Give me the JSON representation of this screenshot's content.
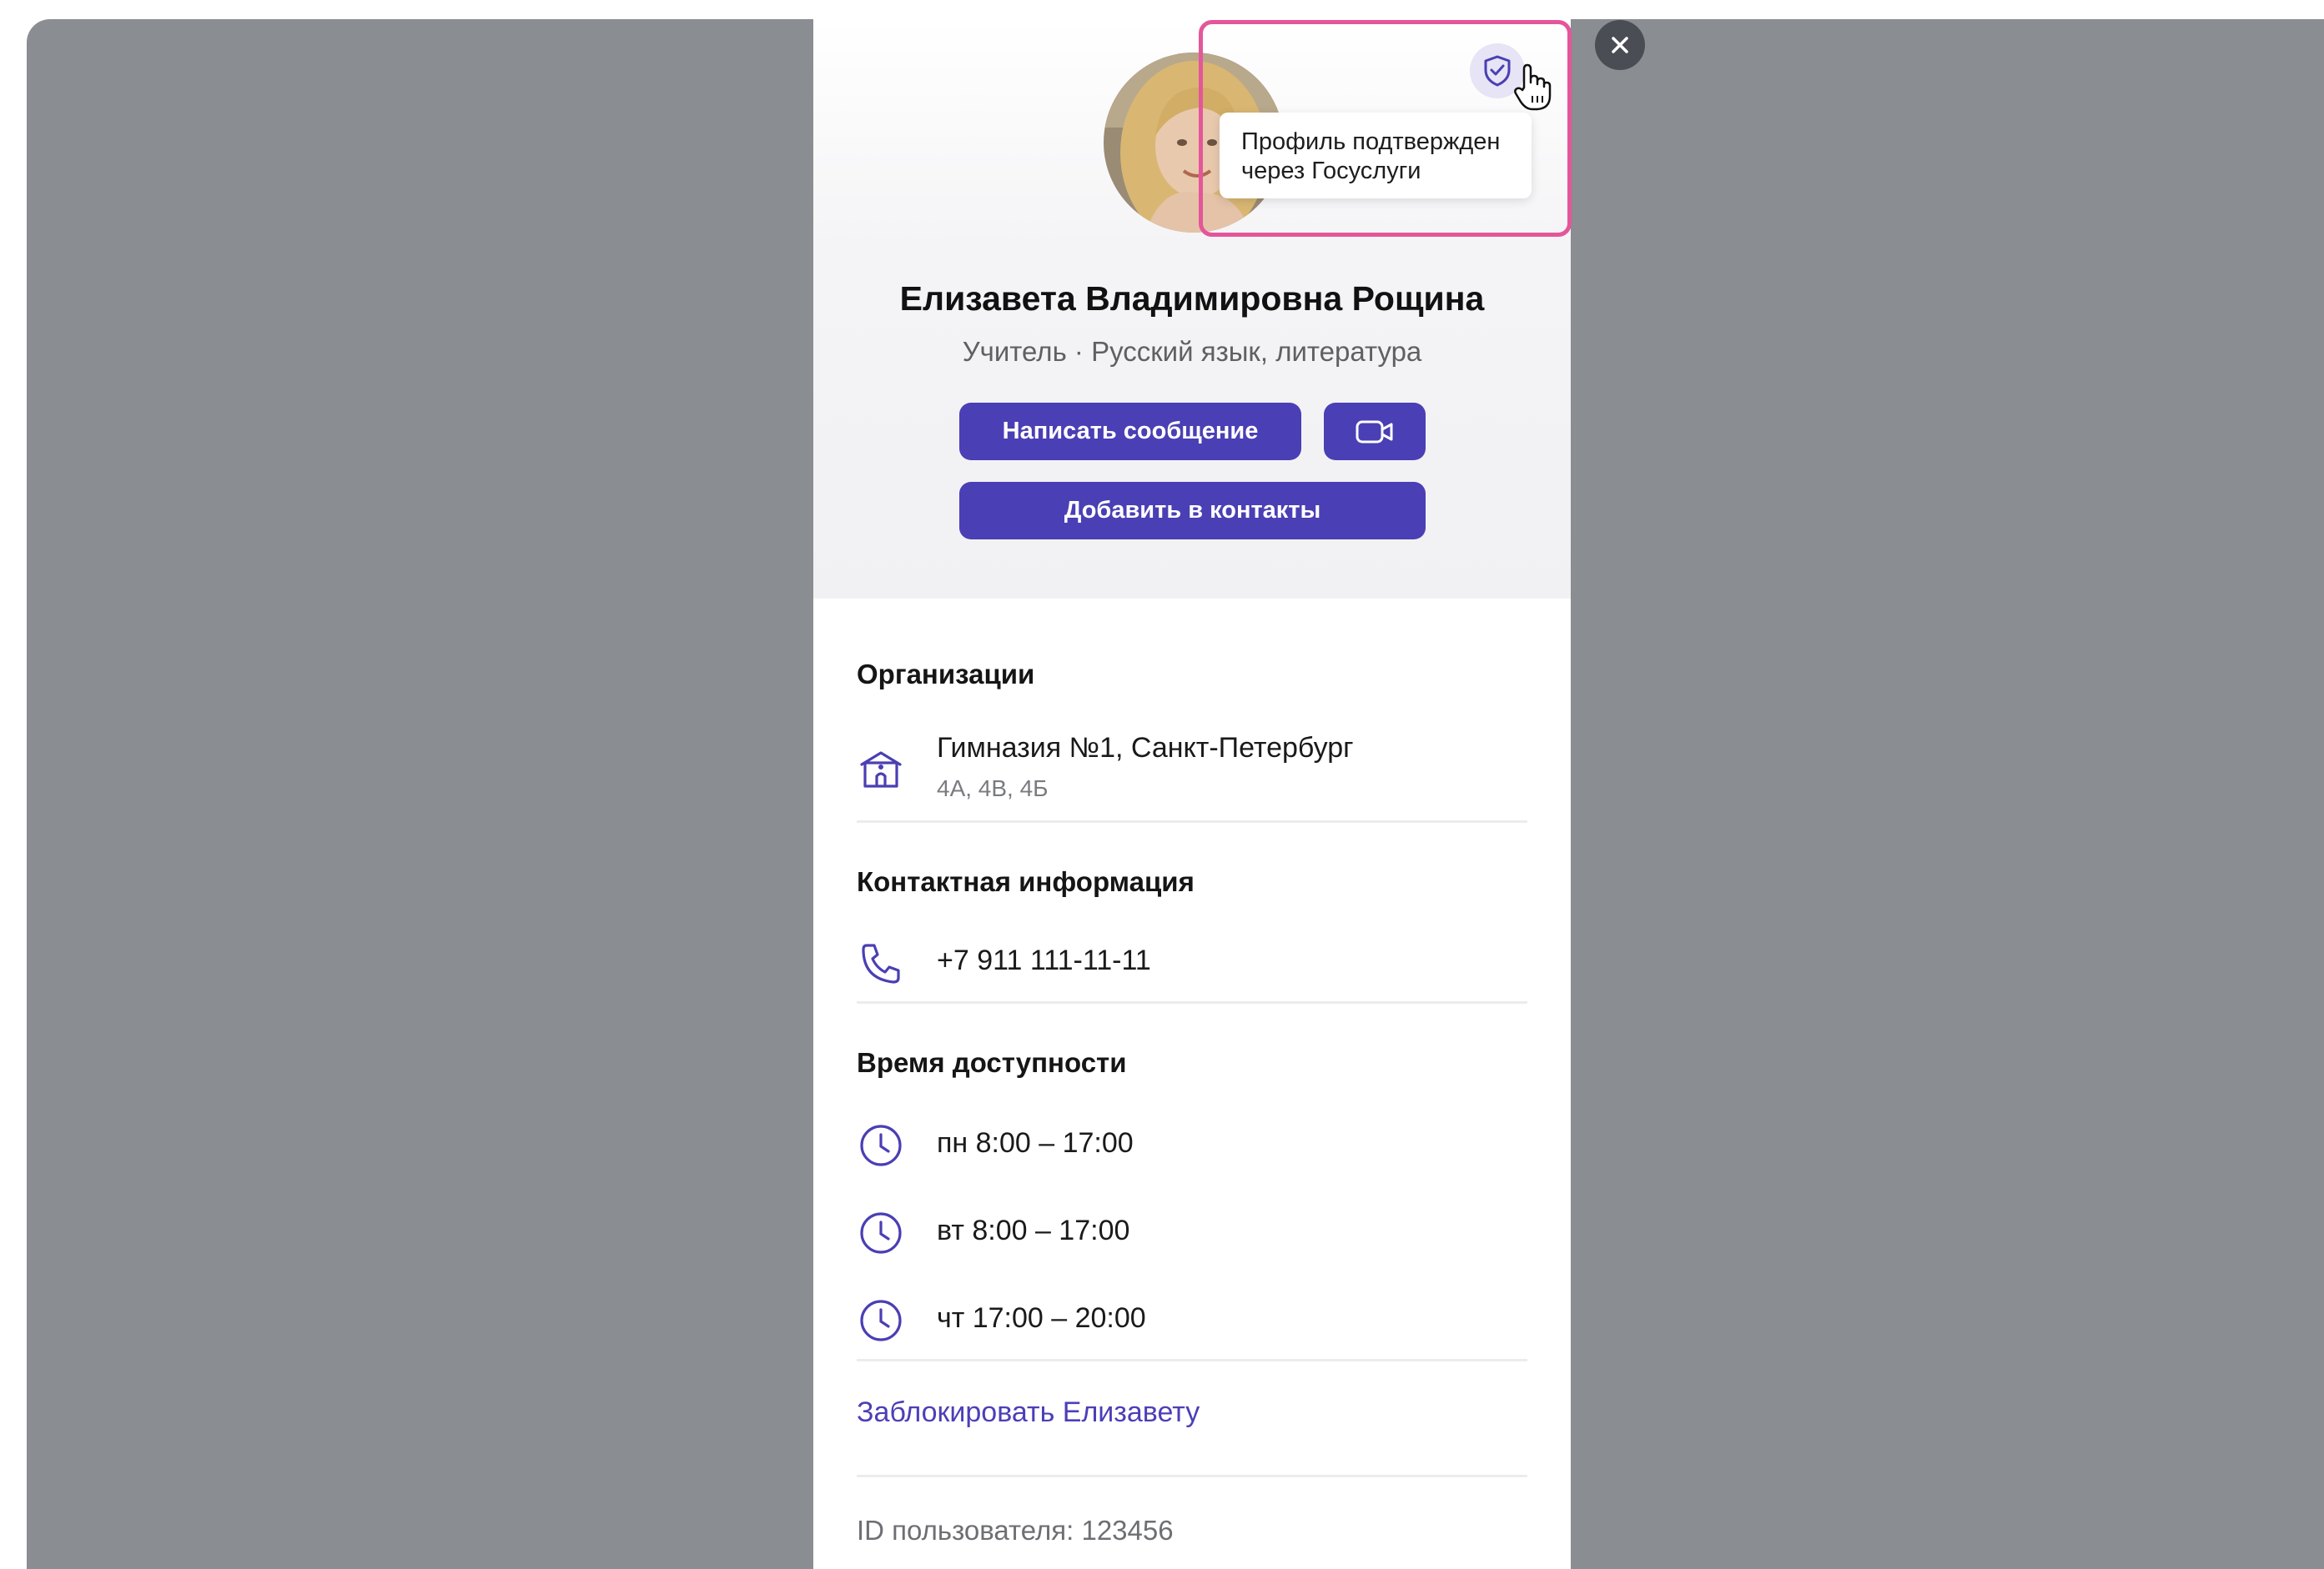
{
  "tooltip": {
    "line1": "Профиль подтвержден",
    "line2": "через Госуслуги"
  },
  "profile": {
    "name": "Елизавета Владимировна Рощина",
    "role": "Учитель · Русский язык, литература"
  },
  "actions": {
    "message_label": "Написать сообщение",
    "add_contact_label": "Добавить в контакты"
  },
  "organizations": {
    "title": "Организации",
    "name": "Гимназия №1, Санкт-Петербург",
    "classes": "4А, 4В, 4Б"
  },
  "contacts": {
    "title": "Контактная информация",
    "phone": "+7 911 111-11-11"
  },
  "availability": {
    "title": "Время доступности",
    "slots": [
      "пн 8:00 – 17:00",
      "вт 8:00 – 17:00",
      "чт 17:00 – 20:00"
    ]
  },
  "block_label": "Заблокировать Елизавету",
  "user_id_label": "ID пользователя: 123456",
  "colors": {
    "accent": "#4a3fb4",
    "highlight": "#e4569a",
    "overlay": "#8a8d91"
  }
}
